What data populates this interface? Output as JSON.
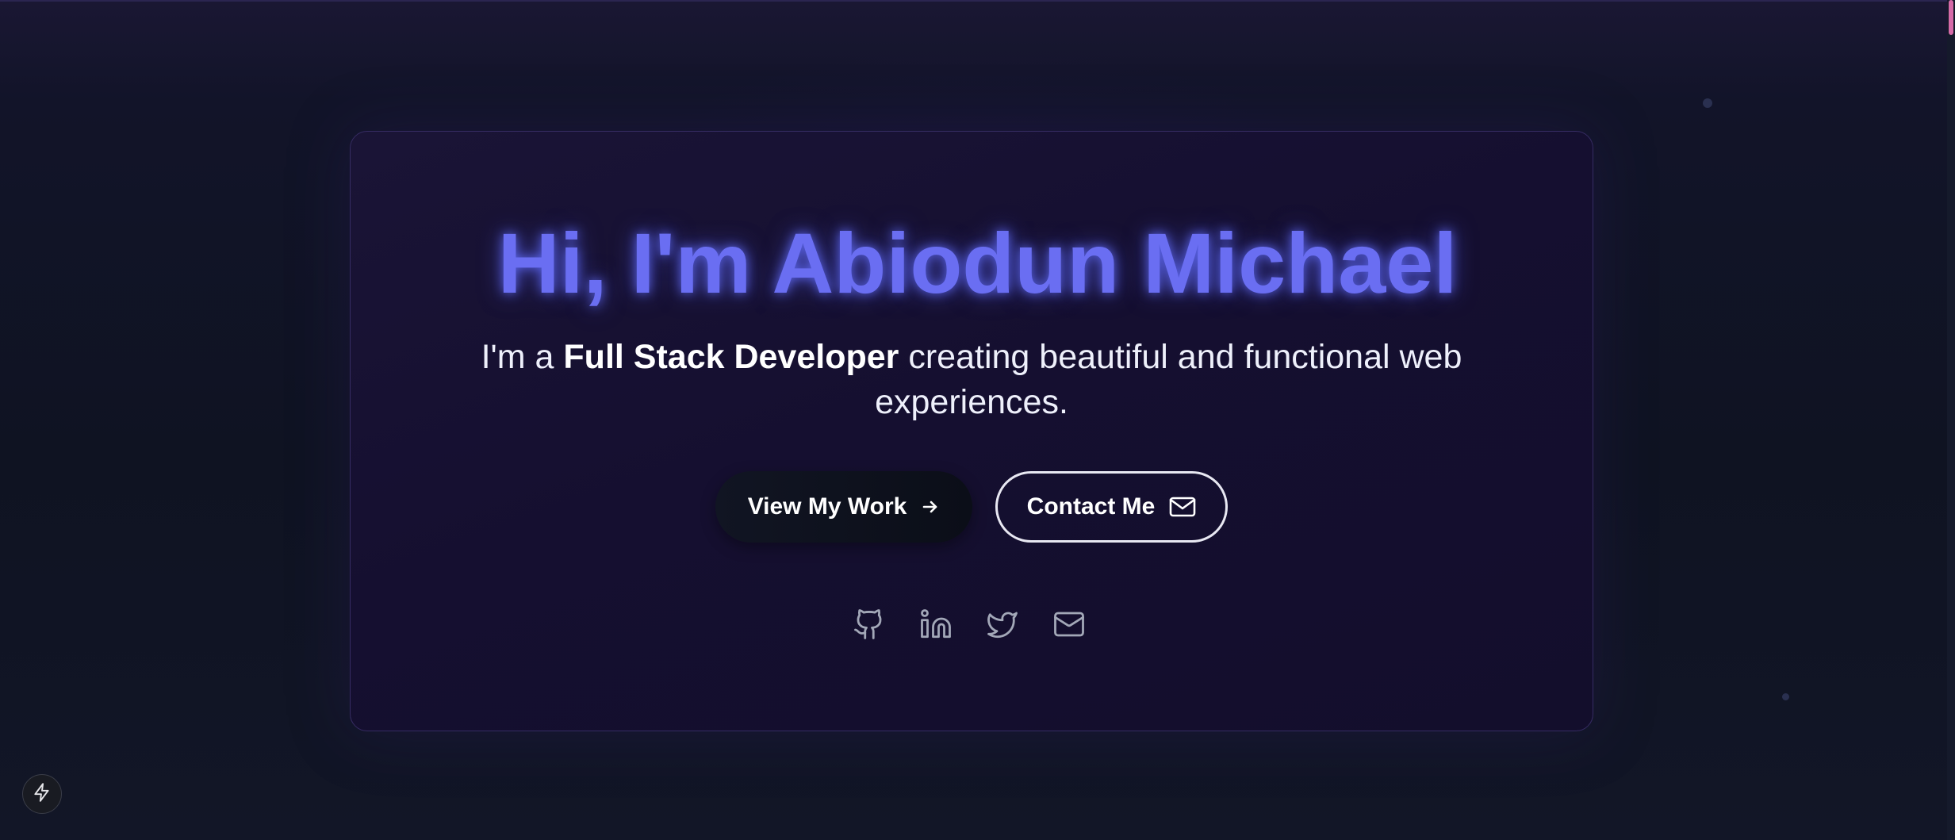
{
  "hero": {
    "title": "Hi, I'm Abiodun Michael",
    "subtitle_prefix": "I'm a ",
    "subtitle_role": "Full Stack Developer",
    "subtitle_suffix": " creating beautiful and functional web experiences."
  },
  "buttons": {
    "view_work_label": "View My Work",
    "view_work_icon": "arrow-right-icon",
    "contact_label": "Contact Me",
    "contact_icon": "mail-icon"
  },
  "socials": [
    {
      "name": "GitHub",
      "icon": "github-icon"
    },
    {
      "name": "LinkedIn",
      "icon": "linkedin-icon"
    },
    {
      "name": "Twitter",
      "icon": "twitter-icon"
    },
    {
      "name": "Email",
      "icon": "mail-icon"
    }
  ],
  "floating_button": {
    "icon": "lightning-bolt-icon"
  },
  "colors": {
    "background": "#0f1322",
    "card": "#150f30",
    "title": "#6a6ef2",
    "scroll_thumb": "#d66aa8"
  }
}
